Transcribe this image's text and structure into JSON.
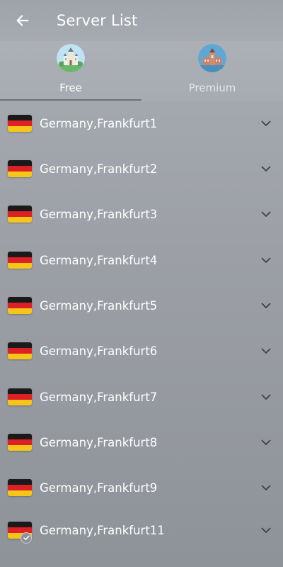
{
  "header": {
    "title": "Server List",
    "back_icon": "arrow-left-icon"
  },
  "tabs": [
    {
      "label": "Free",
      "icon": "castle-icon",
      "active": true
    },
    {
      "label": "Premium",
      "icon": "palace-icon",
      "active": false
    }
  ],
  "servers": [
    {
      "name": "Germany,Frankfurt1",
      "flag": "germany-flag-icon"
    },
    {
      "name": "Germany,Frankfurt2",
      "flag": "germany-flag-icon"
    },
    {
      "name": "Germany,Frankfurt3",
      "flag": "germany-flag-icon"
    },
    {
      "name": "Germany,Frankfurt4",
      "flag": "germany-flag-icon"
    },
    {
      "name": "Germany,Frankfurt5",
      "flag": "germany-flag-icon"
    },
    {
      "name": "Germany,Frankfurt6",
      "flag": "germany-flag-icon"
    },
    {
      "name": "Germany,Frankfurt7",
      "flag": "germany-flag-icon"
    },
    {
      "name": "Germany,Frankfurt8",
      "flag": "germany-flag-icon"
    },
    {
      "name": "Germany,Frankfurt9",
      "flag": "germany-flag-icon"
    },
    {
      "name": "Germany,Frankfurt11",
      "flag": "germany-flag-icon",
      "selected": true
    }
  ],
  "colors": {
    "flag_black": "#1a1a1a",
    "flag_red": "#dd1f26",
    "flag_gold": "#f5c518"
  }
}
